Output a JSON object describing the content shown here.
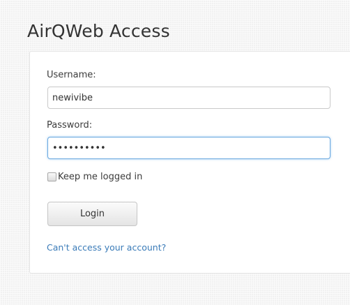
{
  "page": {
    "title": "AirQWeb Access"
  },
  "login_form": {
    "username_label": "Username:",
    "username_value": "newivibe",
    "password_label": "Password:",
    "password_value": "••••••••••",
    "remember_label": "Keep me logged in",
    "remember_checked": false,
    "login_button_label": "Login",
    "help_link_text": "Can't access your account?"
  },
  "colors": {
    "link": "#3a7bb8",
    "focus_ring": "#6aa8df"
  }
}
